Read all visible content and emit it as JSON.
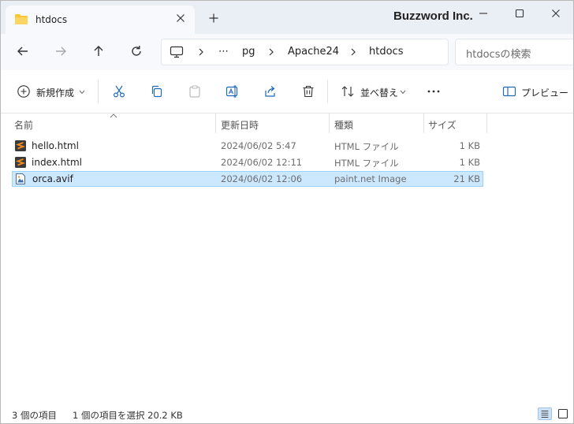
{
  "window": {
    "tab_title": "htdocs",
    "brand": "Buzzword Inc."
  },
  "breadcrumb": {
    "items": [
      "⋯",
      "pg",
      "Apache24",
      "htdocs"
    ]
  },
  "search": {
    "placeholder": "htdocsの検索"
  },
  "toolbar": {
    "new_label": "新規作成",
    "sort_label": "並べ替え",
    "preview_label": "プレビュー"
  },
  "columns": [
    "名前",
    "更新日時",
    "種類",
    "サイズ"
  ],
  "files": [
    {
      "name": "hello.html",
      "date": "2024/06/02 5:47",
      "type": "HTML ファイル",
      "size": "1 KB",
      "icon": "sublime-file-icon"
    },
    {
      "name": "index.html",
      "date": "2024/06/02 12:11",
      "type": "HTML ファイル",
      "size": "1 KB",
      "icon": "sublime-file-icon"
    },
    {
      "name": "orca.avif",
      "date": "2024/06/02 12:06",
      "type": "paint.net Image",
      "size": "21 KB",
      "icon": "image-file-icon",
      "selected": true
    }
  ],
  "status": {
    "count": "3 個の項目",
    "selection": "1 個の項目を選択  20.2 KB"
  },
  "colors": {
    "titlebar": "#eaeef5",
    "selection": "#cce8ff",
    "sublime_orange": "#f28b1d"
  }
}
